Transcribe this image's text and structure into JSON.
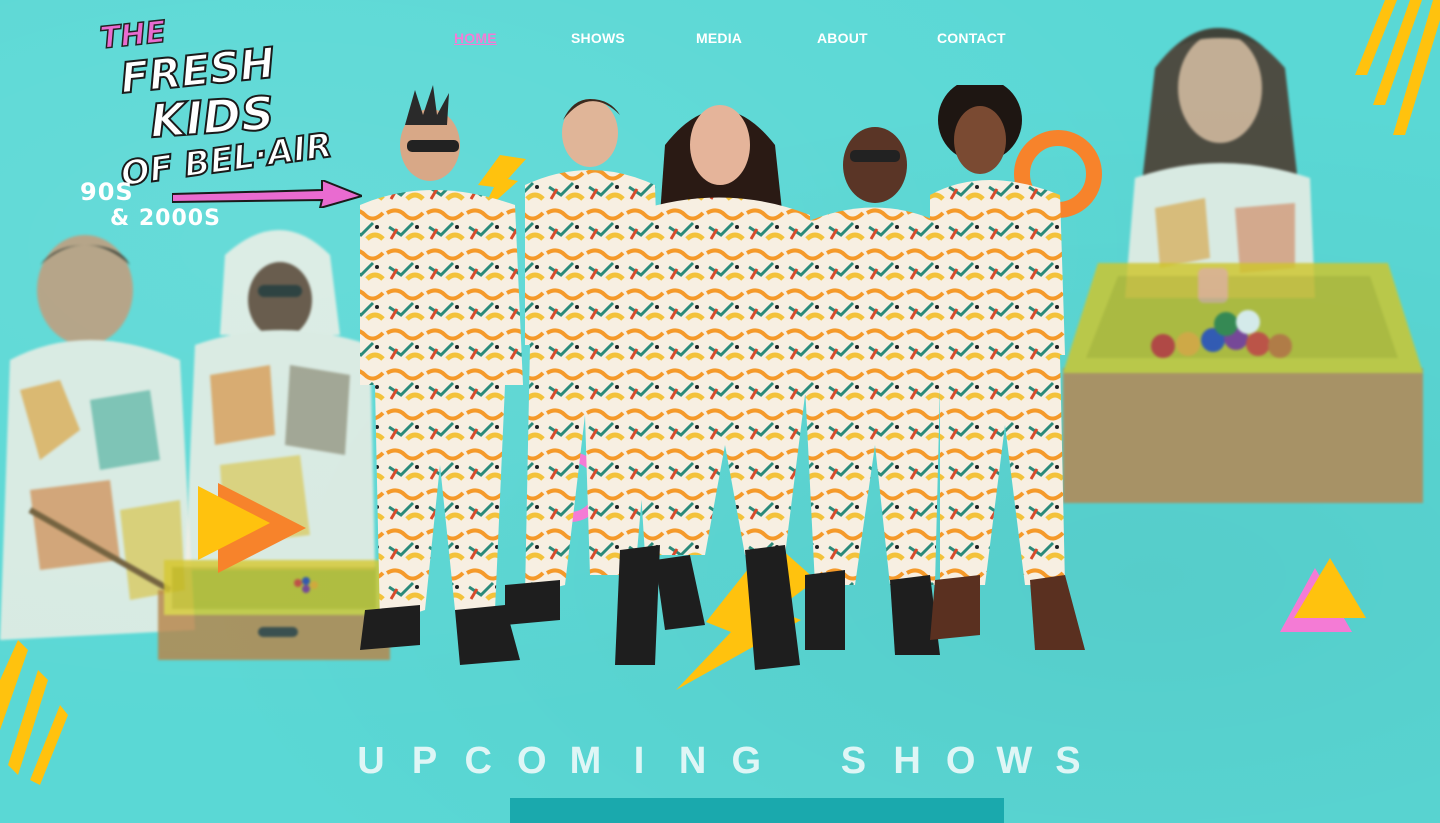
{
  "nav": {
    "items": [
      {
        "label": "HOME",
        "active": true
      },
      {
        "label": "SHOWS",
        "active": false
      },
      {
        "label": "MEDIA",
        "active": false
      },
      {
        "label": "ABOUT",
        "active": false
      },
      {
        "label": "CONTACT",
        "active": false
      }
    ]
  },
  "logo": {
    "the": "THE",
    "line1": "FRESH",
    "line2": "KIDS",
    "line3": "OF BEL·AIR",
    "sub1": "90S",
    "sub2": "& 2000S"
  },
  "heading": {
    "letters": [
      "U",
      "P",
      "C",
      "O",
      "M",
      "I",
      "N",
      "G",
      "",
      "S",
      "H",
      "O",
      "W",
      "S"
    ],
    "text": "UPCOMING SHOWS"
  },
  "colors": {
    "background": "#5ad8d5",
    "accent_pink": "#f47bd5",
    "accent_yellow": "#ffc20e",
    "accent_orange": "#f7832b",
    "section_bar": "#1aa9ad"
  }
}
